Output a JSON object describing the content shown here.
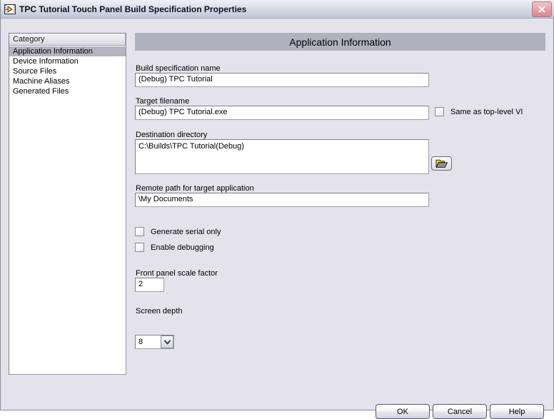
{
  "window": {
    "title": "TPC Tutorial Touch Panel Build Specification Properties",
    "icon": "labview-vi-icon",
    "close_icon": "close-icon",
    "accent_header_color": "#b0b2c0",
    "close_button_color": "#e6a2a8"
  },
  "category": {
    "header": "Category",
    "items": [
      {
        "label": "Application Information",
        "selected": true
      },
      {
        "label": "Device Information",
        "selected": false
      },
      {
        "label": "Source Files",
        "selected": false
      },
      {
        "label": "Machine Aliases",
        "selected": false
      },
      {
        "label": "Generated Files",
        "selected": false
      }
    ]
  },
  "panel": {
    "title": "Application Information",
    "build_spec_name": {
      "label": "Build specification name",
      "value": "(Debug) TPC Tutorial"
    },
    "target_filename": {
      "label": "Target filename",
      "value": "(Debug) TPC Tutorial.exe"
    },
    "same_as_top_level": {
      "label": "Same as top-level VI",
      "checked": false
    },
    "destination_directory": {
      "label": "Destination directory",
      "value": "C:\\Builds\\TPC Tutorial(Debug)",
      "browse_icon": "folder-open-icon"
    },
    "remote_path": {
      "label": "Remote path for target application",
      "value": "\\My Documents"
    },
    "generate_serial_only": {
      "label": "Generate serial only",
      "checked": false
    },
    "enable_debugging": {
      "label": "Enable debugging",
      "checked": false
    },
    "front_panel_scale_factor": {
      "label": "Front panel scale factor",
      "value": "2"
    },
    "screen_depth": {
      "label": "Screen depth",
      "value": "8",
      "arrow_icon": "chevron-down-icon"
    }
  },
  "footer": {
    "ok": "OK",
    "cancel": "Cancel",
    "help": "Help"
  }
}
